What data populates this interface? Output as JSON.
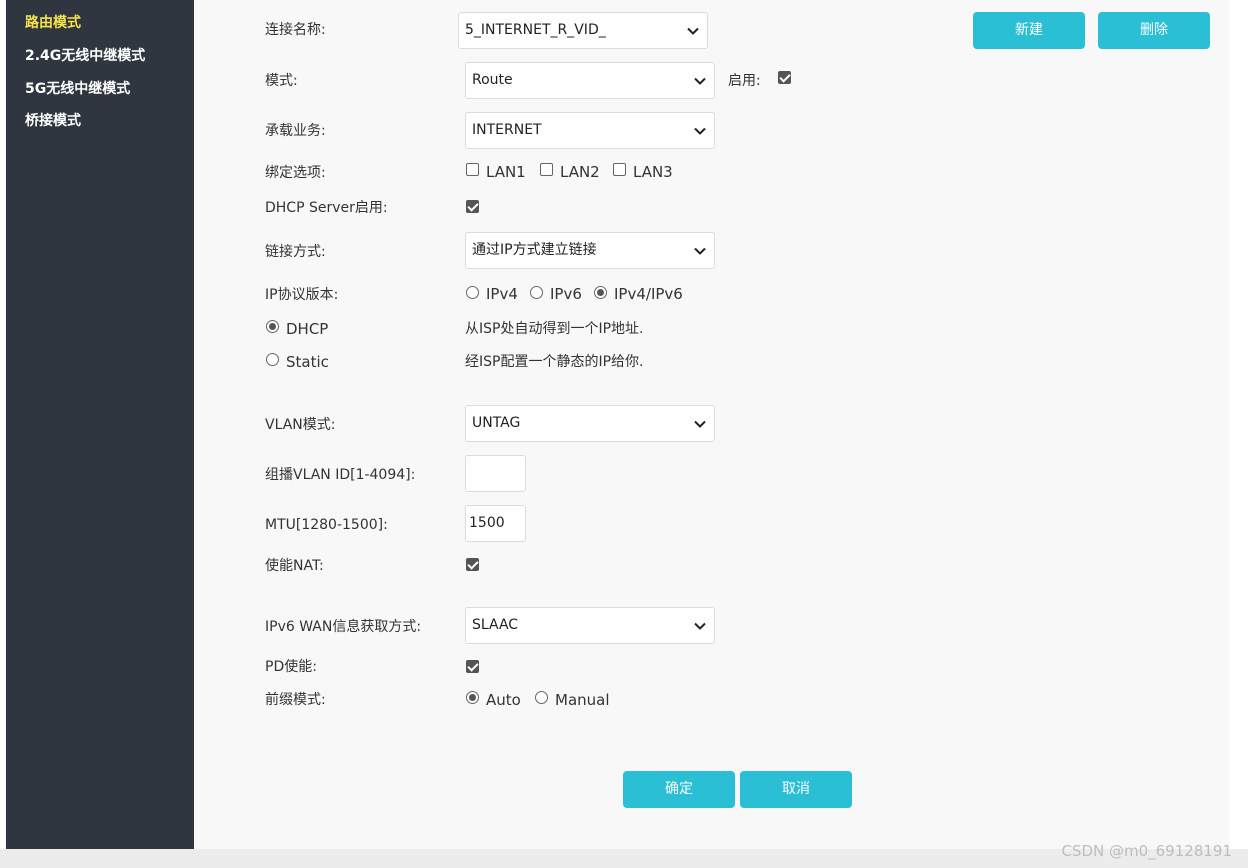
{
  "sidebar": {
    "items": [
      {
        "label": "路由模式",
        "active": true
      },
      {
        "label": "2.4G无线中继模式",
        "active": false
      },
      {
        "label": "5G无线中继模式",
        "active": false
      },
      {
        "label": "桥接模式",
        "active": false
      }
    ]
  },
  "form": {
    "connection_name": {
      "label": "连接名称:",
      "value": "5_INTERNET_R_VID_"
    },
    "mode": {
      "label": "模式:",
      "value": "Route",
      "enable_label": "启用:",
      "enable_checked": true
    },
    "service": {
      "label": "承载业务:",
      "value": "INTERNET"
    },
    "binding": {
      "label": "绑定选项:",
      "options": [
        {
          "label": "LAN1",
          "checked": false
        },
        {
          "label": "LAN2",
          "checked": false
        },
        {
          "label": "LAN3",
          "checked": false
        }
      ]
    },
    "dhcp_server": {
      "label": "DHCP Server启用:",
      "checked": true
    },
    "link_method": {
      "label": "链接方式:",
      "value": "通过IP方式建立链接"
    },
    "ip_version": {
      "label": "IP协议版本:",
      "options": [
        {
          "label": "IPv4",
          "checked": false
        },
        {
          "label": "IPv6",
          "checked": false
        },
        {
          "label": "IPv4/IPv6",
          "checked": true
        }
      ]
    },
    "addressing": [
      {
        "label": "DHCP",
        "checked": true,
        "description": "从ISP处自动得到一个IP地址."
      },
      {
        "label": "Static",
        "checked": false,
        "description": "经ISP配置一个静态的IP给你."
      }
    ],
    "vlan_mode": {
      "label": "VLAN模式:",
      "value": "UNTAG"
    },
    "multicast_vlan": {
      "label": "组播VLAN ID[1-4094]:",
      "value": ""
    },
    "mtu": {
      "label": "MTU[1280-1500]:",
      "value": "1500"
    },
    "nat": {
      "label": "使能NAT:",
      "checked": true
    },
    "ipv6_wan": {
      "label": "IPv6 WAN信息获取方式:",
      "value": "SLAAC"
    },
    "pd": {
      "label": "PD使能:",
      "checked": true
    },
    "prefix_mode": {
      "label": "前缀模式:",
      "options": [
        {
          "label": "Auto",
          "checked": true
        },
        {
          "label": "Manual",
          "checked": false
        }
      ]
    }
  },
  "buttons": {
    "new": "新建",
    "delete": "删除",
    "confirm": "确定",
    "cancel": "取消"
  },
  "watermark": "CSDN @m0_69128191",
  "colors": {
    "sidebar_bg": "#2f3640",
    "active_item": "#f5e34a",
    "accent_button": "#2bbfd6",
    "content_bg": "#f8f8f8"
  }
}
